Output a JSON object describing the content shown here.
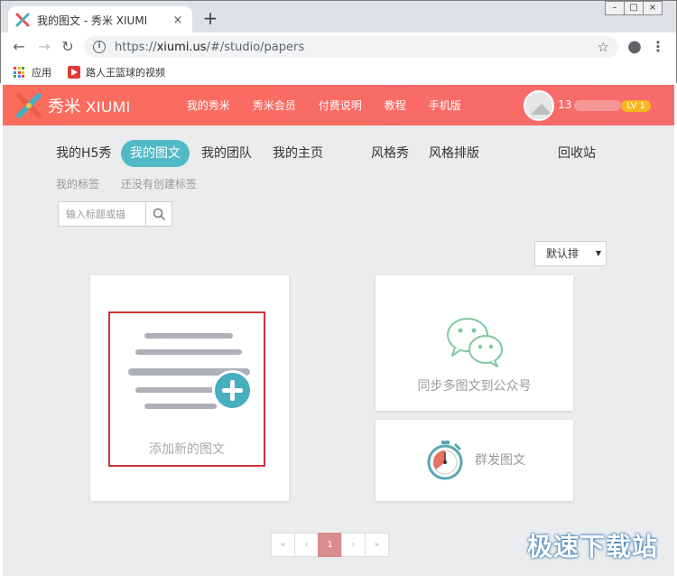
{
  "browser": {
    "tab_title": "我的图文 - 秀米 XIUMI",
    "tab_close": "×",
    "new_tab": "+",
    "window_controls": [
      "–",
      "□",
      "×"
    ],
    "back": "←",
    "forward": "→",
    "reload": "↻",
    "url_prefix": "https://",
    "url_host": "xiumi.us",
    "url_path": "/#/studio/papers",
    "bookmark_star": "☆",
    "account": "●",
    "menu": "⋮",
    "bookmarks": [
      {
        "label": "应用",
        "icon": "apps-grid-icon"
      },
      {
        "label": "路人王篮球的视频",
        "icon": "video-play-icon"
      }
    ]
  },
  "header": {
    "logo_cn": "秀米",
    "logo_en": "XIUMI",
    "nav": [
      "我的秀米",
      "秀米会员",
      "付费说明",
      "教程",
      "手机版"
    ],
    "username_prefix": "13",
    "level_badge": "LV 1"
  },
  "studio": {
    "tabs": [
      {
        "label": "我的H5秀",
        "active": false
      },
      {
        "label": "我的图文",
        "active": true
      },
      {
        "label": "我的团队",
        "active": false
      },
      {
        "label": "我的主页",
        "active": false
      },
      {
        "label": "风格秀",
        "active": false
      },
      {
        "label": "风格排版",
        "active": false
      },
      {
        "label": "回收站",
        "active": false
      }
    ],
    "tags_label": "我的标签",
    "tags_empty": "还没有创建标签",
    "search_placeholder": "输入标题或描",
    "sort_label": "默认排",
    "sort_caret": "▼"
  },
  "cards": {
    "add_new": "添加新的图文",
    "sync": "同步多图文到公众号",
    "mass_send": "群发图文"
  },
  "pagination": {
    "items": [
      "«",
      "‹",
      "1",
      "›",
      "»"
    ],
    "active_page": "1"
  },
  "watermark": "极速下载站",
  "colors": {
    "header_gradient": [
      "#fb6c5d",
      "#f76b6b"
    ],
    "active_tab": "#50b9c6",
    "add_border": "#c9353a",
    "plus_circle": "#45aebf",
    "level_badge": "#f8b620",
    "wechat_green": "#7fc8a0",
    "page_active": "#d98c8c"
  }
}
